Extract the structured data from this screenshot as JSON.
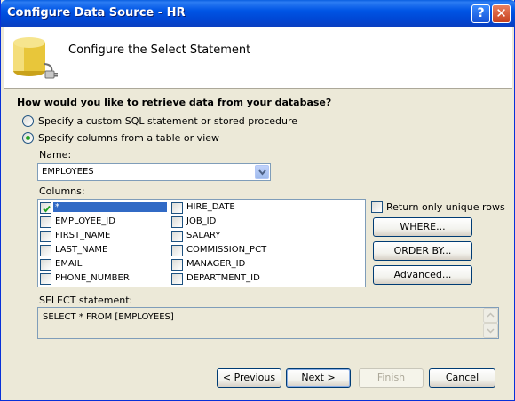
{
  "window": {
    "title": "Configure Data Source - HR",
    "help_glyph": "?",
    "close_glyph": "✕"
  },
  "header": {
    "title": "Configure the Select Statement",
    "icon": "database-plug-icon"
  },
  "question": "How would you like to retrieve data from your database?",
  "options": {
    "custom_sql": {
      "label": "Specify a custom SQL statement or stored procedure",
      "checked": false
    },
    "columns": {
      "label": "Specify columns from a table or view",
      "checked": true
    }
  },
  "name_field": {
    "label": "Name:",
    "value": "EMPLOYEES"
  },
  "columns": {
    "label": "Columns:",
    "left": [
      {
        "name": "*",
        "checked": true,
        "selected": true
      },
      {
        "name": "EMPLOYEE_ID",
        "checked": false
      },
      {
        "name": "FIRST_NAME",
        "checked": false
      },
      {
        "name": "LAST_NAME",
        "checked": false
      },
      {
        "name": "EMAIL",
        "checked": false
      },
      {
        "name": "PHONE_NUMBER",
        "checked": false
      }
    ],
    "right": [
      {
        "name": "HIRE_DATE",
        "checked": false
      },
      {
        "name": "JOB_ID",
        "checked": false
      },
      {
        "name": "SALARY",
        "checked": false
      },
      {
        "name": "COMMISSION_PCT",
        "checked": false
      },
      {
        "name": "MANAGER_ID",
        "checked": false
      },
      {
        "name": "DEPARTMENT_ID",
        "checked": false
      }
    ]
  },
  "side": {
    "unique_rows_label": "Return only unique rows",
    "unique_rows_checked": false,
    "where_label": "WHERE...",
    "order_by_label": "ORDER BY...",
    "advanced_label": "Advanced..."
  },
  "select_statement": {
    "label": "SELECT statement:",
    "value": "SELECT * FROM [EMPLOYEES]"
  },
  "footer": {
    "previous_label": "< Previous",
    "next_label": "Next >",
    "finish_label": "Finish",
    "cancel_label": "Cancel"
  },
  "colors": {
    "title_bar": "#0055E5",
    "dialog_bg": "#ECE9D8",
    "selection": "#316AC5",
    "check_green": "#21A121"
  }
}
